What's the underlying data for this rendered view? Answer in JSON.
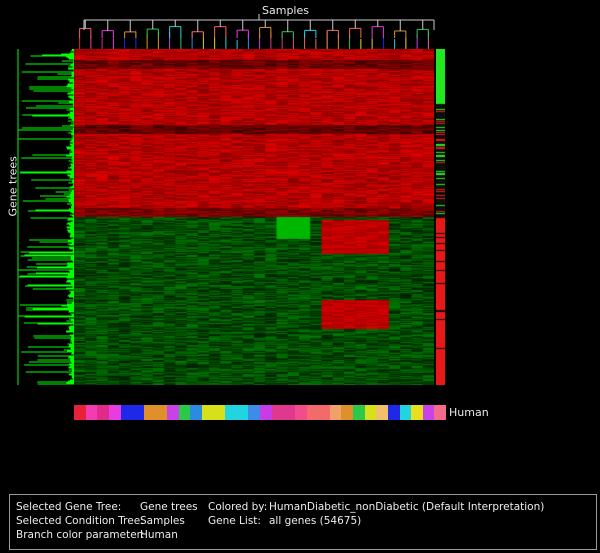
{
  "labels": {
    "samples": "Samples",
    "gene_trees": "Gene trees",
    "human": "Human"
  },
  "info": {
    "selected_gene_tree_key": "Selected Gene Tree:",
    "selected_gene_tree_val": "Gene trees",
    "selected_condition_tree_key": "Selected Condition Tree:",
    "selected_condition_tree_val": "Samples",
    "branch_color_key": "Branch color parameter:",
    "branch_color_val": "Human",
    "colored_by_key": "Colored by:",
    "colored_by_val": "HumanDiabetic_nonDiabetic (Default Interpretation)",
    "gene_list_key": "Gene List:",
    "gene_list_val": "all genes (54675)"
  },
  "colors": {
    "up": "#e00000",
    "down": "#18c818",
    "tree_gene": "#00ff00",
    "panel_border": "#9a9a9a"
  },
  "sample_colors": [
    "#e8203a",
    "#f23cb2",
    "#e02a8c",
    "#e83ce0",
    "#2028e8",
    "#2028e8",
    "#e0902a",
    "#e0902a",
    "#c842e8",
    "#2cc84a",
    "#2a8ce0",
    "#d8e01c",
    "#d8e01c",
    "#22d4e0",
    "#22d4e0",
    "#3c8ce8",
    "#c83ce8",
    "#e0388c",
    "#e0388c",
    "#f24c8c",
    "#f26a6a",
    "#f26a6a",
    "#f2a06a",
    "#e0902a",
    "#2cc84a",
    "#d8e01c",
    "#f2c06a",
    "#2028e8",
    "#22d4e0",
    "#e8e01c",
    "#c842e8",
    "#f26a8c"
  ]
}
